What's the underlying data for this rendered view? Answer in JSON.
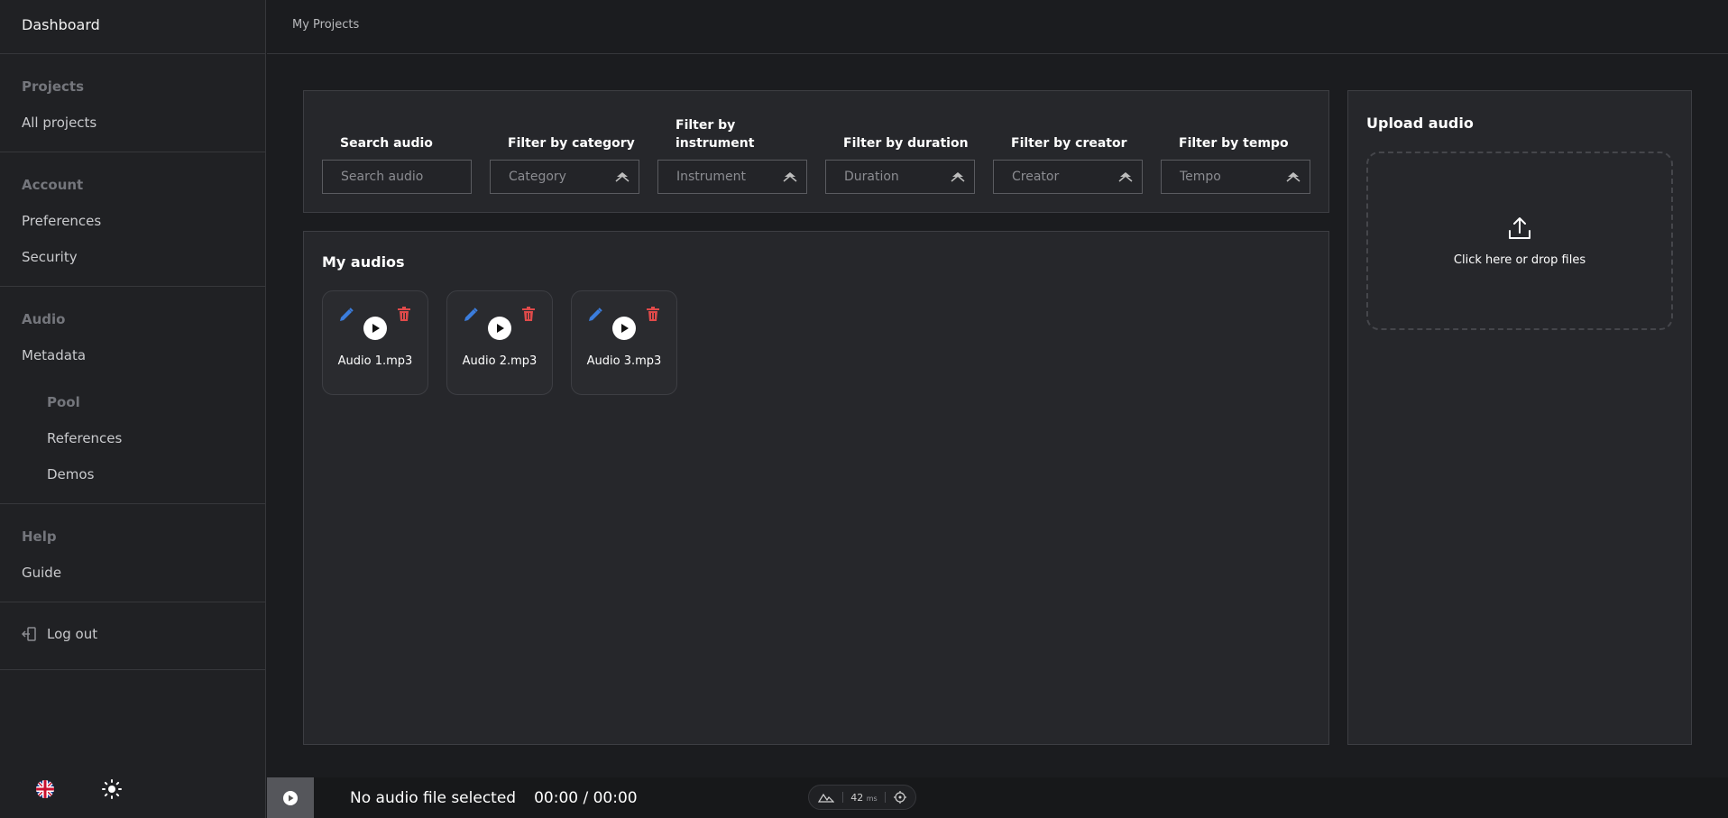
{
  "sidebar": {
    "title": "Dashboard",
    "sections": [
      {
        "heading": "Projects",
        "items": [
          "All projects"
        ]
      },
      {
        "heading": "Account",
        "items": [
          "Preferences",
          "Security"
        ]
      },
      {
        "heading": "Audio",
        "items": [
          "Metadata"
        ],
        "sub_heading": "Pool",
        "sub_items": [
          "References",
          "Demos"
        ]
      },
      {
        "heading": "Help",
        "items": [
          "Guide"
        ]
      }
    ],
    "logout": "Log out",
    "language_icon": "uk-flag-icon",
    "theme_icon": "sun-icon"
  },
  "breadcrumb": "My Projects",
  "filters": [
    {
      "label": "Search audio",
      "placeholder": "Search audio"
    },
    {
      "label": "Filter by category",
      "placeholder": "Category"
    },
    {
      "label": "Filter by instrument",
      "placeholder": "Instrument"
    },
    {
      "label": "Filter by duration",
      "placeholder": "Duration"
    },
    {
      "label": "Filter by creator",
      "placeholder": "Creator"
    },
    {
      "label": "Filter by tempo",
      "placeholder": "Tempo"
    }
  ],
  "audios": {
    "title": "My audios",
    "items": [
      "Audio 1.mp3",
      "Audio 2.mp3",
      "Audio 3.mp3"
    ]
  },
  "upload": {
    "title": "Upload audio",
    "drop_text": "Click here or drop files"
  },
  "player": {
    "track": "No audio file selected",
    "time": "00:00 / 00:00"
  },
  "devbar": {
    "value": "42",
    "unit": "ms"
  },
  "colors": {
    "edit": "#3b7ddd",
    "delete": "#e04a4a",
    "background": "#1b1c1f",
    "panel": "#26272b"
  }
}
